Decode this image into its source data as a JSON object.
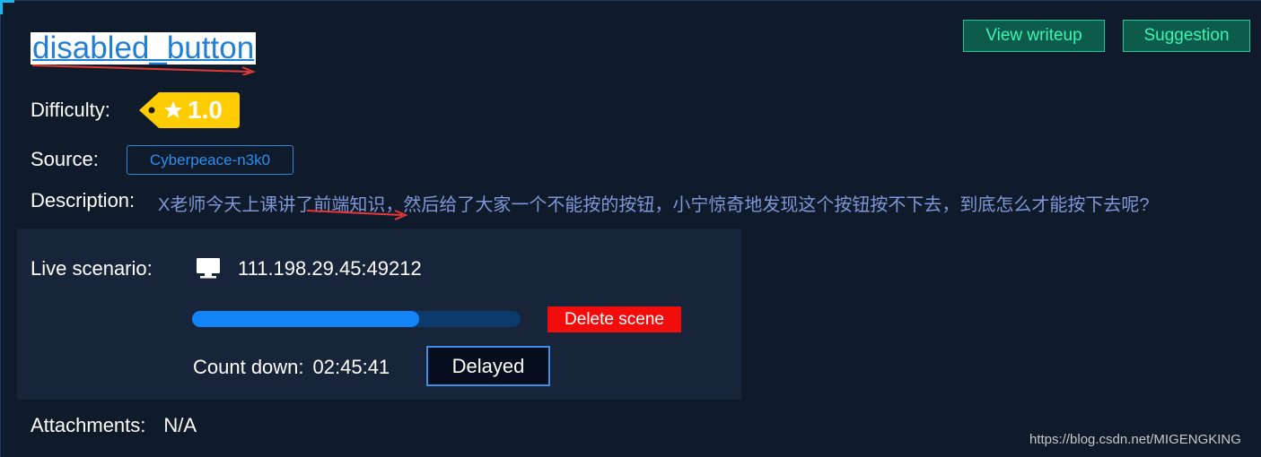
{
  "title": "disabled_button",
  "header_buttons": {
    "writeup": "View writeup",
    "suggestion": "Suggestion"
  },
  "difficulty": {
    "label": "Difficulty:",
    "value": "1.0",
    "icon": "star-icon"
  },
  "source": {
    "label": "Source:",
    "value": "Cyberpeace-n3k0"
  },
  "description": {
    "label": "Description:",
    "text": "X老师今天上课讲了前端知识，然后给了大家一个不能按的按钮，小宁惊奇地发现这个按钮按不下去，到底怎么才能按下去呢?"
  },
  "scenario": {
    "label": "Live scenario:",
    "icon": "monitor-icon",
    "address": "111.198.29.45:49212",
    "progress": 0.69,
    "delete_label": "Delete scene",
    "countdown_label": "Count down:",
    "countdown_value": "02:45:41",
    "delayed_label": "Delayed"
  },
  "attachments": {
    "label": "Attachments:",
    "value": "N/A"
  },
  "watermark": "https://blog.csdn.net/MIGENGKING",
  "colors": {
    "background": "#0f1a2b",
    "panel": "#172439",
    "accent_green": "#3df5b3",
    "progress": "#1284f7",
    "delete": "#f20d0d",
    "tag": "#ffcc00"
  }
}
